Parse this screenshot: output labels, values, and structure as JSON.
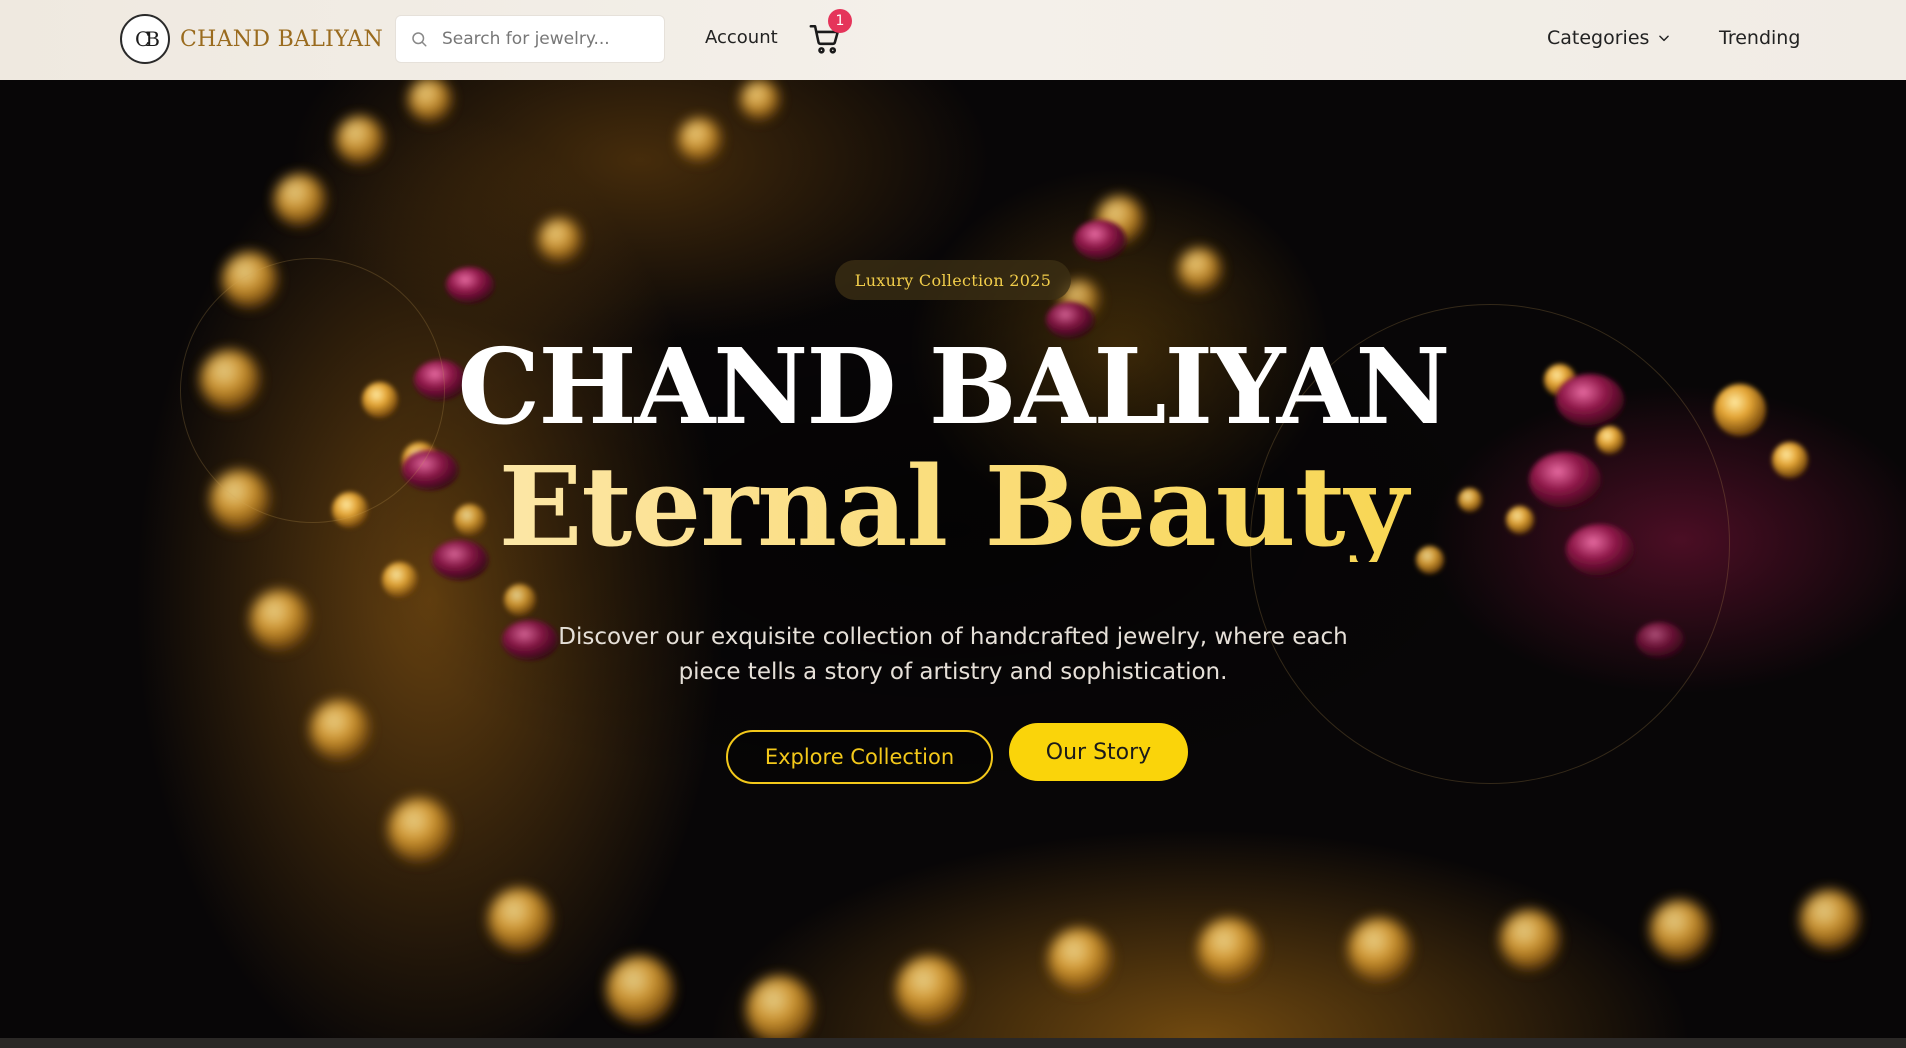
{
  "header": {
    "logo_monogram": "CB",
    "brand_name": "CHAND BALIYAN",
    "search_placeholder": "Search for jewelry...",
    "account_label": "Account",
    "cart_count": "1",
    "categories_label": "Categories",
    "trending_label": "Trending"
  },
  "hero": {
    "badge": "Luxury Collection 2025",
    "title": "CHAND BALIYAN",
    "subtitle": "Eternal Beauty",
    "description": "Discover our exquisite collection of handcrafted jewelry, where each piece tells a story of artistry and sophistication.",
    "primary_cta": "Explore Collection",
    "secondary_cta": "Our Story"
  },
  "colors": {
    "brand_gold": "#9a6b1e",
    "accent_yellow": "#fad40a",
    "cart_badge": "#e5345a"
  },
  "icons": {
    "search": "search-icon",
    "cart": "cart-icon",
    "dropdown": "chevron-down-icon"
  }
}
